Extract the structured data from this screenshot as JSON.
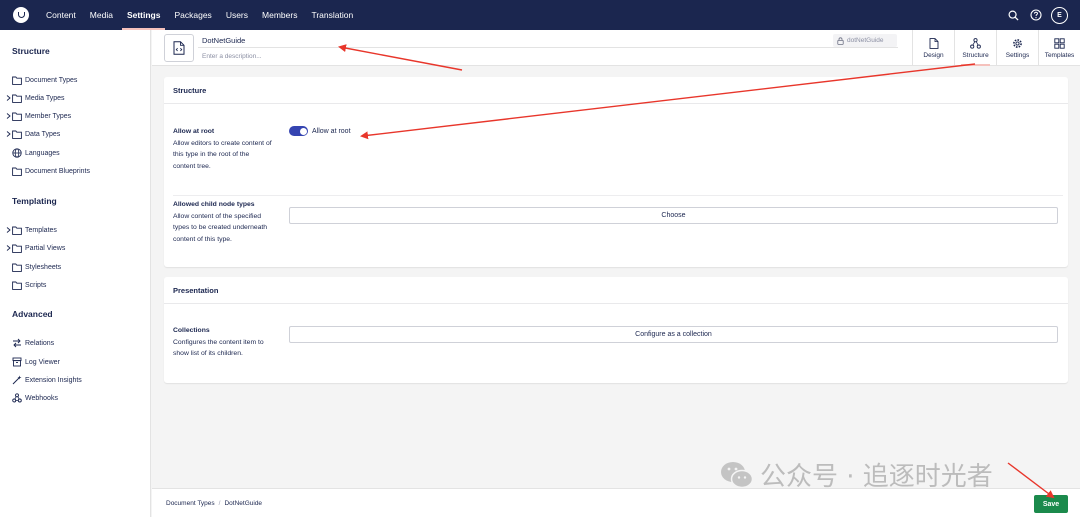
{
  "nav": {
    "items": [
      {
        "label": "Content",
        "active": false
      },
      {
        "label": "Media",
        "active": false
      },
      {
        "label": "Settings",
        "active": true
      },
      {
        "label": "Packages",
        "active": false
      },
      {
        "label": "Users",
        "active": false
      },
      {
        "label": "Members",
        "active": false
      },
      {
        "label": "Translation",
        "active": false
      }
    ],
    "avatar_initial": "E"
  },
  "sidebar": {
    "sections": [
      "Structure",
      "Templating",
      "Advanced"
    ],
    "structure_items": [
      {
        "label": "Document Types",
        "icon": "folder-icon",
        "expandable": false
      },
      {
        "label": "Media Types",
        "icon": "folder-icon",
        "expandable": true
      },
      {
        "label": "Member Types",
        "icon": "folder-icon",
        "expandable": true
      },
      {
        "label": "Data Types",
        "icon": "folder-icon",
        "expandable": true
      },
      {
        "label": "Languages",
        "icon": "globe-icon",
        "expandable": false
      },
      {
        "label": "Document Blueprints",
        "icon": "folder-icon",
        "expandable": false
      }
    ],
    "templating_items": [
      {
        "label": "Templates",
        "icon": "folder-icon",
        "expandable": true
      },
      {
        "label": "Partial Views",
        "icon": "folder-icon",
        "expandable": true
      },
      {
        "label": "Stylesheets",
        "icon": "folder-icon",
        "expandable": false
      },
      {
        "label": "Scripts",
        "icon": "folder-icon",
        "expandable": false
      }
    ],
    "advanced_items": [
      {
        "label": "Relations",
        "icon": "relations-icon",
        "expandable": false
      },
      {
        "label": "Log Viewer",
        "icon": "log-viewer-icon",
        "expandable": false
      },
      {
        "label": "Extension Insights",
        "icon": "wand-icon",
        "expandable": false
      },
      {
        "label": "Webhooks",
        "icon": "webhook-icon",
        "expandable": false
      }
    ]
  },
  "header": {
    "name": "DotNetGuide",
    "alias": "dotNetGuide",
    "description_placeholder": "Enter a description...",
    "tabs": [
      {
        "label": "Design",
        "icon": "document-icon",
        "active": false
      },
      {
        "label": "Structure",
        "icon": "structure-icon",
        "active": true
      },
      {
        "label": "Settings",
        "icon": "gear-icon",
        "active": false
      },
      {
        "label": "Templates",
        "icon": "templates-icon",
        "active": false
      }
    ]
  },
  "structure_box": {
    "title": "Structure",
    "allow_at_root": {
      "title": "Allow at root",
      "description": "Allow editors to create content of this type in the root of the content tree.",
      "toggle_label": "Allow at root",
      "enabled": true
    },
    "allowed_children": {
      "title": "Allowed child node types",
      "description": "Allow content of the specified types to be created underneath content of this type.",
      "button_label": "Choose"
    }
  },
  "presentation_box": {
    "title": "Presentation",
    "collections": {
      "title": "Collections",
      "description": "Configures the content item to show list of its children.",
      "button_label": "Configure as a collection"
    }
  },
  "footer": {
    "breadcrumb": [
      "Document Types",
      "DotNetGuide"
    ],
    "save_label": "Save"
  },
  "watermark": {
    "text": "公众号 · 追逐时光者"
  },
  "colors": {
    "header_bg": "#1b264f",
    "accent_pink": "#f5c1bc",
    "toggle_on": "#3544b1",
    "save_green": "#1b8a4c",
    "annotation_red": "#e8362b"
  }
}
